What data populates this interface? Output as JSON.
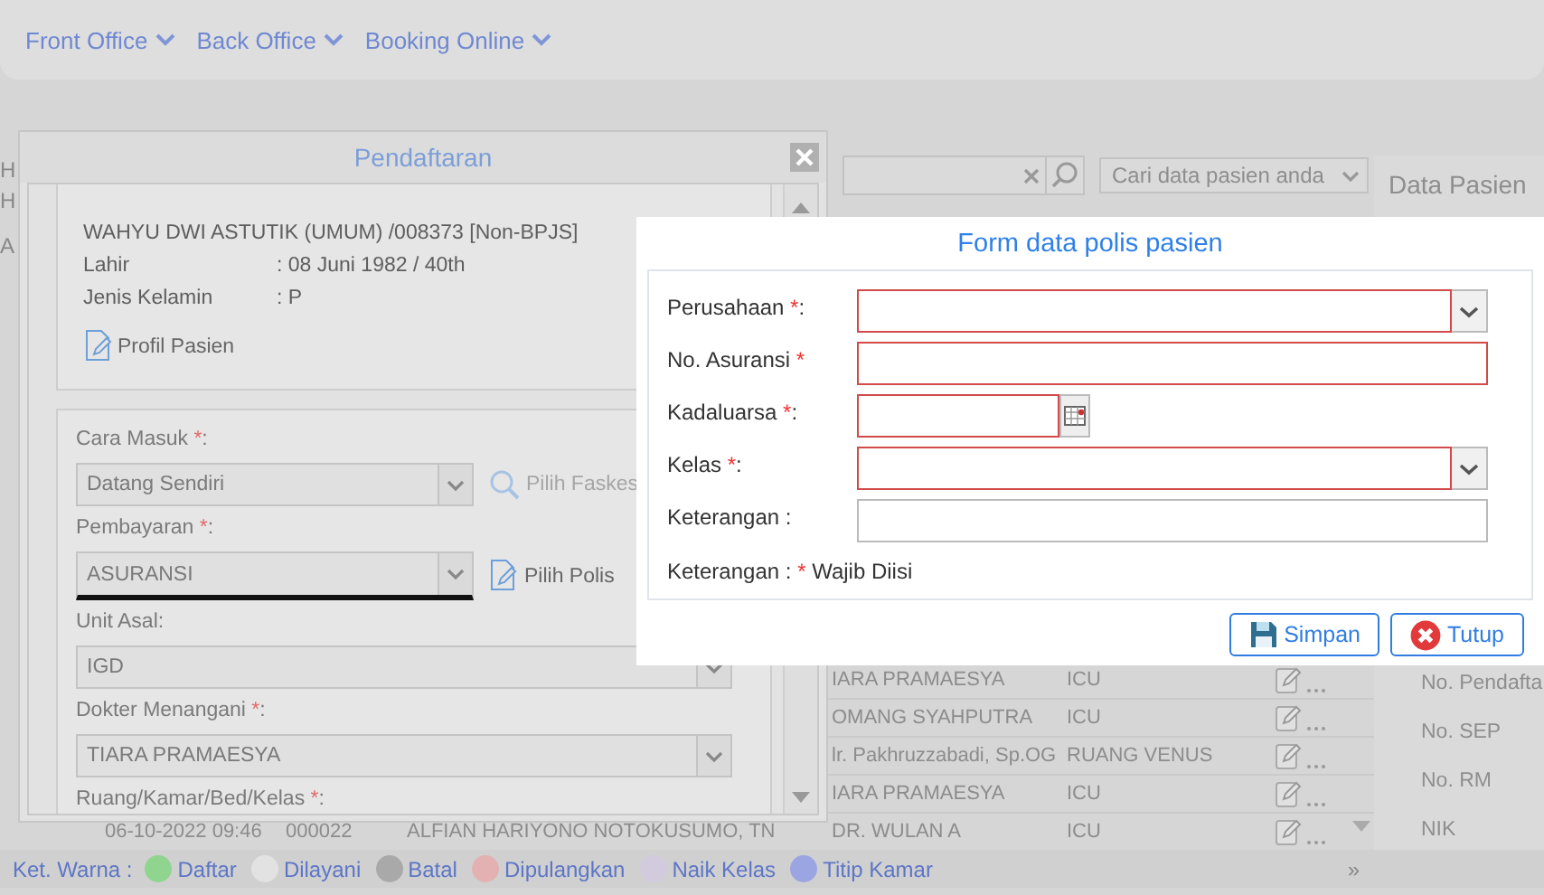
{
  "nav": {
    "items": [
      {
        "label": "Front Office"
      },
      {
        "label": "Back Office"
      },
      {
        "label": "Booking Online"
      }
    ]
  },
  "left_fragments": [
    "H",
    "H",
    "A"
  ],
  "search": {
    "placeholder": "Cari data pasien anda"
  },
  "table": {
    "rows": [
      {
        "doctor": "IARA PRAMAESYA",
        "room": "ICU"
      },
      {
        "doctor": "OMANG SYAHPUTRA",
        "room": "ICU"
      },
      {
        "doctor": "lr. Pakhruzzabadi, Sp.OG",
        "room": "RUANG VENUS"
      },
      {
        "doctor": "IARA PRAMAESYA",
        "room": "ICU"
      },
      {
        "date": "06-10-2022 09:46",
        "number": "000022",
        "patient": "ALFIAN HARIYONO NOTOKUSUMO, TN",
        "doctor": "DR. WULAN A",
        "room": "ICU"
      }
    ]
  },
  "data_pasien": {
    "title": "Data Pasien",
    "labels": [
      "No. Pendafta",
      "No. SEP",
      "No. RM",
      "NIK"
    ]
  },
  "legend": {
    "title": "Ket. Warna :",
    "items": [
      {
        "label": "Daftar",
        "color": "#8fd48f"
      },
      {
        "label": "Dilayani",
        "color": "#e2e2e2"
      },
      {
        "label": "Batal",
        "color": "#a9a9a9"
      },
      {
        "label": "Dipulangkan",
        "color": "#e3b1b1"
      },
      {
        "label": "Naik Kelas",
        "color": "#d2cadd"
      },
      {
        "label": "Titip Kamar",
        "color": "#9aa5e2"
      }
    ],
    "more": "»"
  },
  "pendaftaran": {
    "title": "Pendaftaran",
    "patient": {
      "name": "WAHYU DWI ASTUTIK (UMUM) /008373 [Non-BPJS]",
      "rows": [
        {
          "label": "Lahir",
          "value": ": 08 Juni 1982 / 40th"
        },
        {
          "label": "Jenis Kelamin",
          "value": ": P"
        }
      ],
      "link": "Profil Pasien"
    },
    "fields": [
      {
        "label": "Cara Masuk",
        "required": true,
        "suffix": ":",
        "value": "Datang Sendiri",
        "wide": false,
        "focused": false,
        "action": {
          "label": "Pilih Faskes",
          "kind": "search",
          "disabled": true
        }
      },
      {
        "label": "Pembayaran",
        "required": true,
        "suffix": ":",
        "value": "ASURANSI",
        "wide": false,
        "focused": true,
        "action": {
          "label": "Pilih Polis",
          "kind": "document",
          "disabled": false
        }
      },
      {
        "label": "Unit Asal:",
        "required": false,
        "value": "IGD",
        "wide": true,
        "focused": false
      },
      {
        "label": "Dokter Menangani",
        "required": true,
        "suffix": ":",
        "value": "TIARA PRAMAESYA",
        "wide": true,
        "focused": false
      },
      {
        "label": "Ruang/Kamar/Bed/Kelas",
        "required": true,
        "suffix": ":"
      }
    ]
  },
  "polis_form": {
    "title": "Form data polis pasien",
    "fields": [
      {
        "label": "Perusahaan",
        "required": true,
        "suffix": ":",
        "kind": "select",
        "invalid": true
      },
      {
        "label": "No. Asuransi",
        "required": true,
        "kind": "text",
        "invalid": true
      },
      {
        "label": "Kadaluarsa",
        "required": true,
        "suffix": ":",
        "kind": "date",
        "invalid": true
      },
      {
        "label": "Kelas",
        "required": true,
        "suffix": ":",
        "kind": "select",
        "invalid": true
      },
      {
        "label": "Keterangan :",
        "required": false,
        "kind": "text",
        "invalid": false
      }
    ],
    "note": {
      "prefix": "Keterangan :",
      "mark": "*",
      "text": "Wajib Diisi"
    },
    "buttons": [
      {
        "label": "Simpan",
        "kind": "save"
      },
      {
        "label": "Tutup",
        "kind": "close"
      }
    ]
  }
}
